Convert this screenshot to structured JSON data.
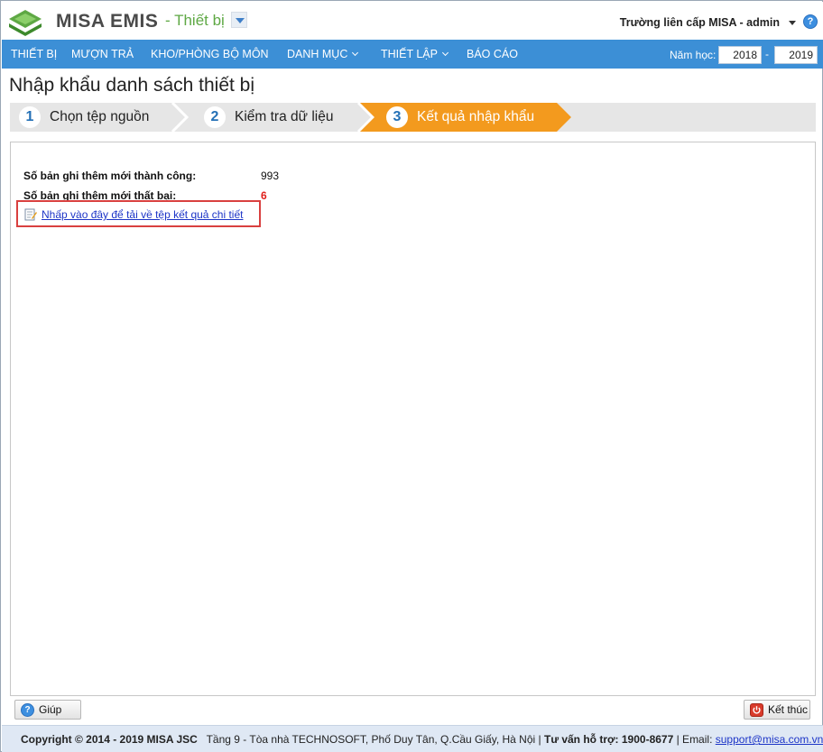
{
  "header": {
    "brand": "MISA EMIS",
    "module": "- Thiết bị",
    "user": "Trường liên cấp MISA - admin",
    "help_icon_text": "?"
  },
  "nav": {
    "items": [
      {
        "label": "THIẾT BỊ"
      },
      {
        "label": "MƯỢN TRẢ"
      },
      {
        "label": "KHO/PHÒNG BỘ MÔN"
      },
      {
        "label": "DANH MỤC",
        "has_dropdown": true
      },
      {
        "label": "THIẾT LẬP",
        "has_dropdown": true
      },
      {
        "label": "BÁO CÁO"
      }
    ],
    "school_year_label": "Năm học:",
    "year_from": "2018",
    "year_sep": "-",
    "year_to": "2019"
  },
  "page": {
    "title": "Nhập khẩu danh sách thiết bị"
  },
  "wizard": {
    "steps": [
      {
        "number": "1",
        "label": "Chọn tệp nguồn",
        "active": false
      },
      {
        "number": "2",
        "label": "Kiểm tra dữ liệu",
        "active": false
      },
      {
        "number": "3",
        "label": "Kết quả nhập khẩu",
        "active": true
      }
    ]
  },
  "result": {
    "success_label": "Số bản ghi thêm mới thành công:",
    "success_value": "993",
    "fail_label": "Số bản ghi thêm mới thất bại:",
    "fail_value": "6",
    "download_link": "Nhấp vào đây để tải về tệp kết quả chi tiết"
  },
  "footer": {
    "help_button": "Giúp",
    "finish_button": "Kết thúc"
  },
  "copyright": {
    "text": "Copyright © 2014 - 2019 MISA JSC",
    "address": "Tầng 9 - Tòa nhà TECHNOSOFT, Phố Duy Tân, Q.Cầu Giấy, Hà Nội |",
    "support_label": "Tư vấn hỗ trợ: 1900-8677",
    "email_label": "| Email:",
    "email": "support@misa.com.vn"
  },
  "colors": {
    "nav_bg": "#3c8fd6",
    "step_active": "#f39a1e",
    "step_inactive": "#e6e6e6",
    "fail_value": "#e0201b",
    "highlight_border": "#d9403f",
    "brand_green": "#5ea844"
  }
}
